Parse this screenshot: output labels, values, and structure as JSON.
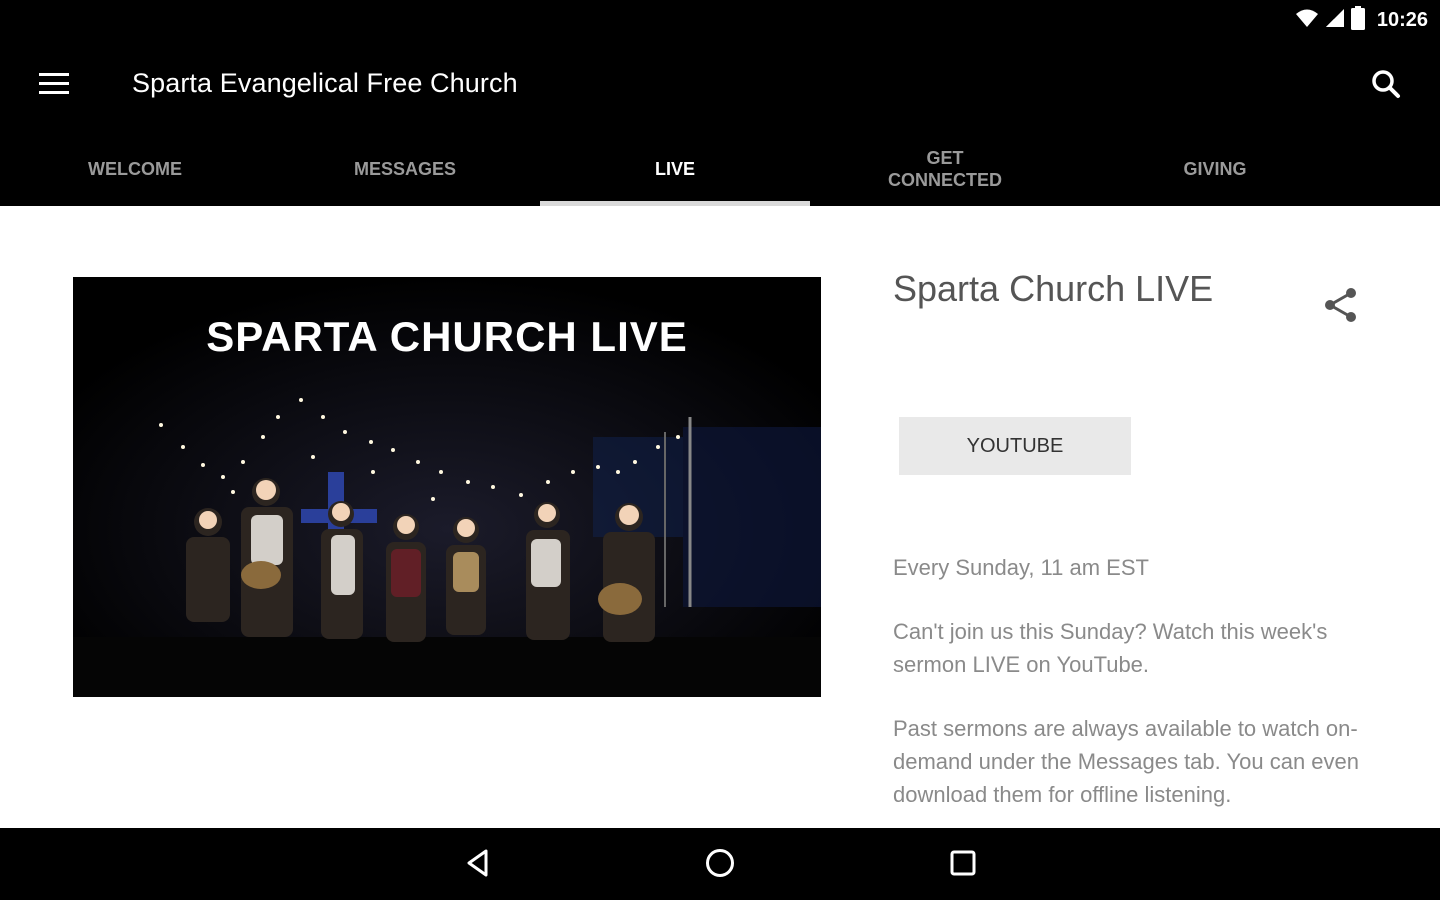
{
  "status_bar": {
    "time": "10:26",
    "icons": [
      "wifi-icon",
      "cellular-signal-icon",
      "battery-icon"
    ]
  },
  "app_bar": {
    "title": "Sparta Evangelical Free Church",
    "menu_icon": "hamburger-menu-icon",
    "search_icon": "search-icon"
  },
  "tabs": [
    {
      "label": "WELCOME",
      "active": false
    },
    {
      "label": "MESSAGES",
      "active": false
    },
    {
      "label": "LIVE",
      "active": true
    },
    {
      "label": "GET CONNECTED",
      "active": false
    },
    {
      "label": "GIVING",
      "active": false
    }
  ],
  "hero": {
    "overlay_text": "SPARTA CHURCH LIVE"
  },
  "detail": {
    "title": "Sparta Church LIVE",
    "share_icon": "share-icon",
    "youtube_button_label": "YOUTUBE",
    "schedule": "Every Sunday, 11 am EST",
    "paragraph_1": "Can't join us this Sunday? Watch this week's sermon LIVE on YouTube.",
    "paragraph_2": "Past sermons are always available to watch on-demand under the Messages tab. You can even download them for offline listening."
  },
  "nav_bar": {
    "icons": [
      "back-icon",
      "home-icon",
      "recents-icon"
    ]
  },
  "colors": {
    "bar_background": "#000000",
    "tab_active": "#ffffff",
    "tab_inactive": "#9a9a9a",
    "tab_indicator": "#d9d9d9",
    "button_background": "#e9e9e9",
    "body_text": "#8a8a8a"
  }
}
